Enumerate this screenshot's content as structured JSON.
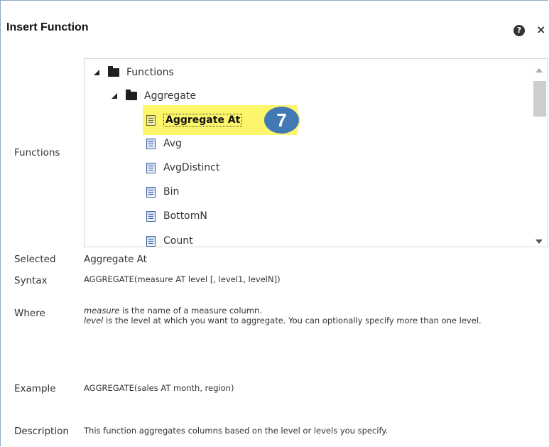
{
  "dialog": {
    "title": "Insert Function",
    "help_icon": "help-icon",
    "close_icon": "close-icon",
    "help_glyph": "?",
    "close_glyph": "×"
  },
  "labels": {
    "functions": "Functions",
    "selected": "Selected",
    "syntax": "Syntax",
    "where": "Where",
    "example": "Example",
    "description": "Description"
  },
  "tree": {
    "root": "Functions",
    "group": "Aggregate",
    "items": [
      "Aggregate At",
      "Avg",
      "AvgDistinct",
      "Bin",
      "BottomN",
      "Count"
    ],
    "selected_index": 0,
    "badge": "7"
  },
  "details": {
    "selected": "Aggregate At",
    "syntax": "AGGREGATE(measure AT level [, level1, levelN])",
    "where_line1_term": "measure",
    "where_line1_rest": " is the name of a measure column.",
    "where_line2_term": "level",
    "where_line2_rest": " is the level at which you want to aggregate. You can optionally specify more than one level.",
    "example": "AGGREGATE(sales AT month, region)",
    "description": "This function aggregates columns based on the level or levels you specify."
  },
  "colors": {
    "highlight": "#fdf66b",
    "badge": "#4279b5",
    "dialog_border": "#8fa7c4"
  }
}
